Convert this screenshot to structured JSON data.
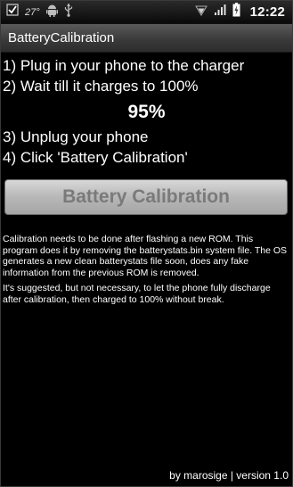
{
  "status_bar": {
    "temperature": "27°",
    "time": "12:22",
    "icons": [
      "checkbox-icon",
      "android-icon",
      "usb-icon",
      "wifi-icon",
      "signal-icon",
      "battery-icon"
    ]
  },
  "app": {
    "title": "BatteryCalibration"
  },
  "steps": {
    "step1": "1) Plug in your phone to the charger",
    "step2": "2) Wait till it charges to 100%",
    "battery_level": "95%",
    "step3": "3) Unplug your phone",
    "step4": "4) Click 'Battery Calibration'"
  },
  "button": {
    "label": "Battery Calibration"
  },
  "info": {
    "paragraph1": "Calibration needs to be done after flashing a new ROM. This program does it by removing the batterystats.bin system file. The OS generates a new clean batterystats file soon, does any fake information from the previous ROM is removed.",
    "paragraph2": "It's suggested, but not necessary, to let the phone fully discharge after calibration, then charged to 100% without break."
  },
  "footer": {
    "credit": "by marosige | version 1.0"
  }
}
